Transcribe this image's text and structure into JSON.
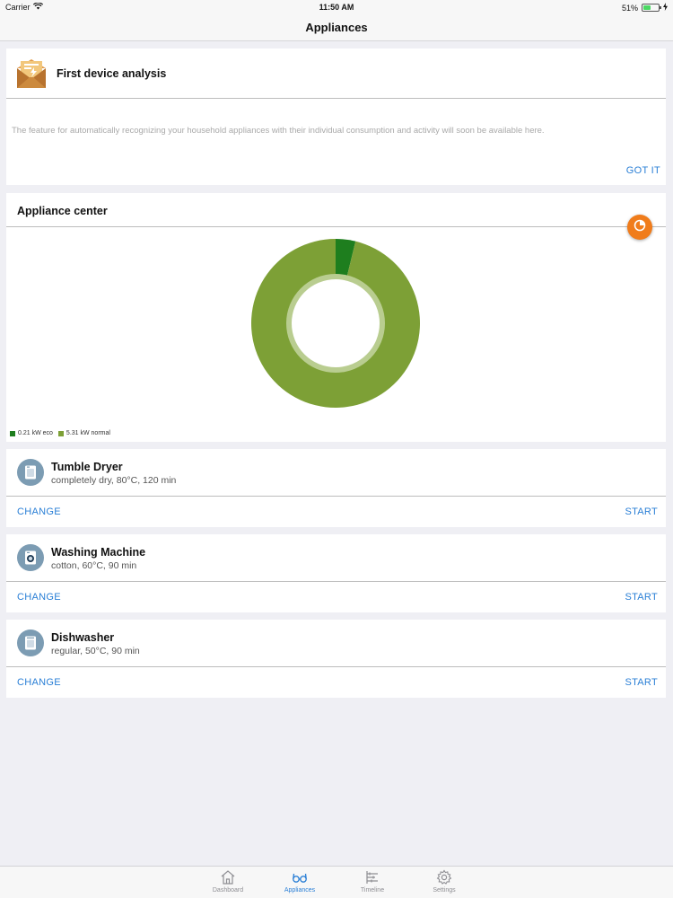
{
  "status_bar": {
    "carrier": "Carrier",
    "time": "11:50 AM",
    "battery_text": "51%",
    "battery_level": 0.51
  },
  "nav": {
    "title": "Appliances"
  },
  "analysis_card": {
    "title": "First device analysis",
    "text": "The feature for automatically recognizing your household appliances with their individual consumption and activity will soon be available here.",
    "action": "GOT IT",
    "icon": "envelope-bolt-icon"
  },
  "appliance_center": {
    "title": "Appliance center",
    "button_icon": "pie-chart-icon",
    "legend": [
      {
        "label": "0.21 kW eco",
        "color": "#1e7e1e"
      },
      {
        "label": "5.31 kW normal",
        "color": "#7da036"
      }
    ]
  },
  "chart_data": {
    "type": "pie",
    "categories": [
      "eco",
      "normal"
    ],
    "values": [
      0.21,
      5.31
    ],
    "units": "kW",
    "legend_position": "bottom-left",
    "colors": [
      "#1e7e1e",
      "#7da036"
    ]
  },
  "appliances": [
    {
      "name": "Tumble Dryer",
      "desc": "completely dry, 80°C, 120 min",
      "icon": "dryer-icon",
      "change": "CHANGE",
      "start": "START"
    },
    {
      "name": "Washing Machine",
      "desc": "cotton, 60°C, 90 min",
      "icon": "washing-machine-icon",
      "change": "CHANGE",
      "start": "START"
    },
    {
      "name": "Dishwasher",
      "desc": "regular, 50°C, 90 min",
      "icon": "dishwasher-icon",
      "change": "CHANGE",
      "start": "START"
    }
  ],
  "tabs": [
    {
      "label": "Dashboard",
      "icon": "house-icon",
      "active": false
    },
    {
      "label": "Appliances",
      "icon": "glasses-icon",
      "active": true
    },
    {
      "label": "Timeline",
      "icon": "timeline-icon",
      "active": false
    },
    {
      "label": "Settings",
      "icon": "gear-icon",
      "active": false
    }
  ],
  "colors": {
    "accent": "#2a7fd6",
    "orange": "#f07c1b",
    "icon_bg": "#7c9cb3"
  }
}
